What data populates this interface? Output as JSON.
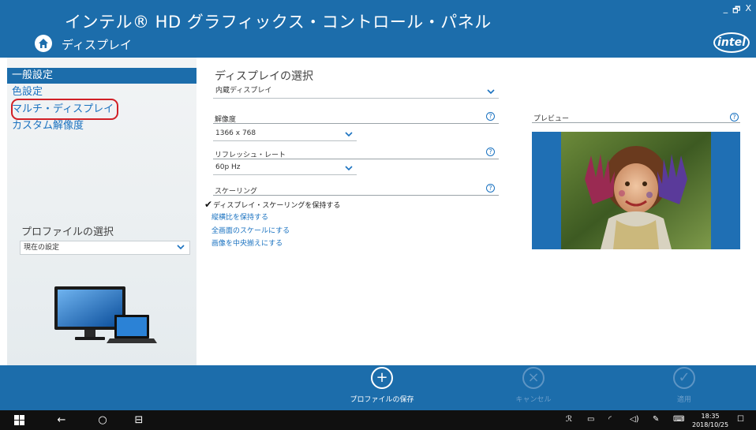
{
  "window": {
    "title": "インテル® HD グラフィックス・コントロール・パネル",
    "section": "ディスプレイ",
    "controls": {
      "minimize": "_",
      "restore": "Æ",
      "close": "X"
    },
    "logo_text": "intel"
  },
  "sidebar": {
    "items": [
      {
        "label": "一般設定",
        "active": true
      },
      {
        "label": "色設定",
        "active": false
      },
      {
        "label": "マルチ・ディスプレイ",
        "active": false,
        "highlighted": true
      },
      {
        "label": "カスタム解像度",
        "active": false
      }
    ],
    "profile_label": "プロファイルの選択",
    "profile_value": "現在の設定"
  },
  "main": {
    "display_select_title": "ディスプレイの選択",
    "display_select_value": "内蔵ディスプレイ",
    "resolution": {
      "label": "解像度",
      "value": "1366 x 768"
    },
    "refresh": {
      "label": "リフレッシュ・レート",
      "value": "60p Hz"
    },
    "scaling": {
      "label": "スケーリング",
      "options": [
        {
          "label": "ディスプレイ・スケーリングを保持する",
          "checked": true
        },
        {
          "label": "縦横比を保持する",
          "checked": false
        },
        {
          "label": "全画面のスケールにする",
          "checked": false
        },
        {
          "label": "画像を中央揃えにする",
          "checked": false
        }
      ]
    },
    "preview_label": "プレビュー"
  },
  "actions": {
    "save_profile": "プロファイルの保存",
    "cancel": "キャンセル",
    "apply": "適用"
  },
  "taskbar": {
    "time": "18:35",
    "date": "2018/10/25"
  },
  "colors": {
    "accent": "#1c6dab",
    "link": "#1a72c0",
    "highlight": "#d12027"
  }
}
